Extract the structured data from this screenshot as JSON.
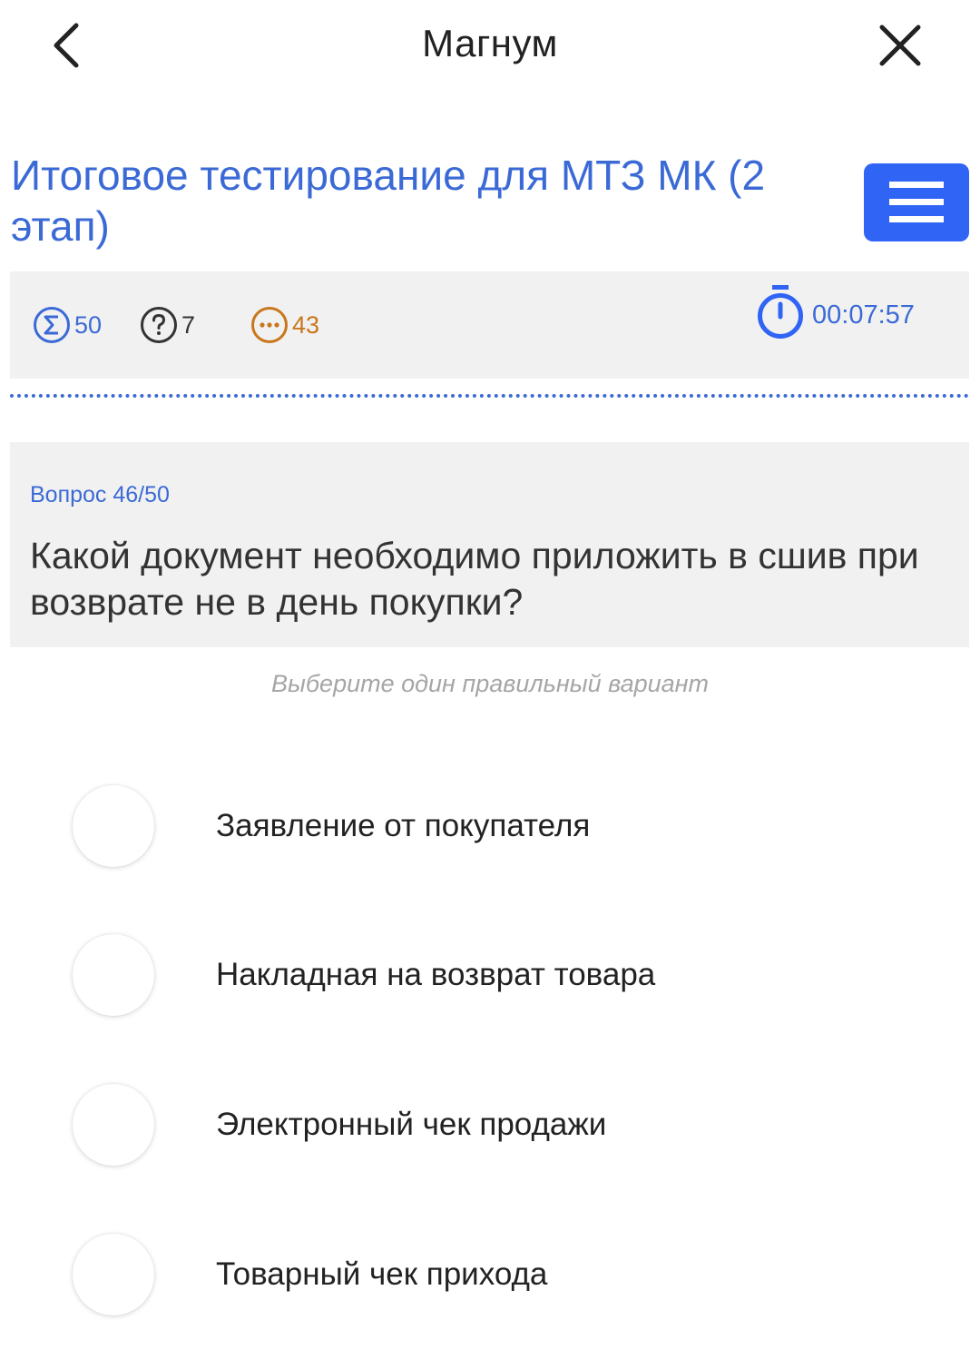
{
  "header": {
    "title": "Магнум",
    "back_icon": "chevron-left-icon",
    "close_icon": "close-icon"
  },
  "test": {
    "title": " Итоговое тестирование для МТЗ МК (2 этап)",
    "menu_icon": "hamburger-menu-icon"
  },
  "stats": {
    "total": "50",
    "unanswered": "7",
    "skipped": "43",
    "timer": "00:07:57"
  },
  "question": {
    "counter": "Вопрос 46/50",
    "text": "Какой документ необходимо приложить в сшив при возврате не в день покупки?",
    "hint": "Выберите один правильный вариант"
  },
  "answers": [
    {
      "label": "Заявление от покупателя",
      "selected": false
    },
    {
      "label": "Накладная на возврат товара",
      "selected": false
    },
    {
      "label": "Электронный чек продажи",
      "selected": false
    },
    {
      "label": "Товарный чек прихода",
      "selected": false
    }
  ],
  "colors": {
    "accent": "#3b6ad6",
    "menu_button": "#2f64f5",
    "skipped": "#c9771c",
    "panel_bg": "#f1f1f1"
  }
}
